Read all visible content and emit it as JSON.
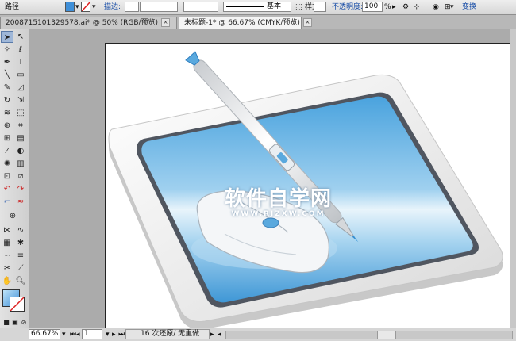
{
  "control_bar": {
    "path_label": "路径",
    "stroke_label": "描边:",
    "stroke_profile": "基本",
    "style_label": "样式:",
    "opacity_label": "不透明度:",
    "opacity_value": "100",
    "opacity_unit": "%",
    "transform_label": "变换"
  },
  "tabs": [
    {
      "label": "20087151013295​78.ai* @ 50% (RGB/预览)"
    },
    {
      "label": "未标题-1* @ 66.67% (CMYK/预览)"
    }
  ],
  "status": {
    "zoom": "66.67%",
    "page": "1",
    "info": "16 次还原/ 无重做"
  },
  "watermark": {
    "main": "软件自学网",
    "sub": "WWW.RJZXW.COM"
  },
  "colors": {
    "accent": "#4aa3de",
    "screen_light": "#e8f4fb",
    "pen_blue": "#2f8fd6"
  }
}
